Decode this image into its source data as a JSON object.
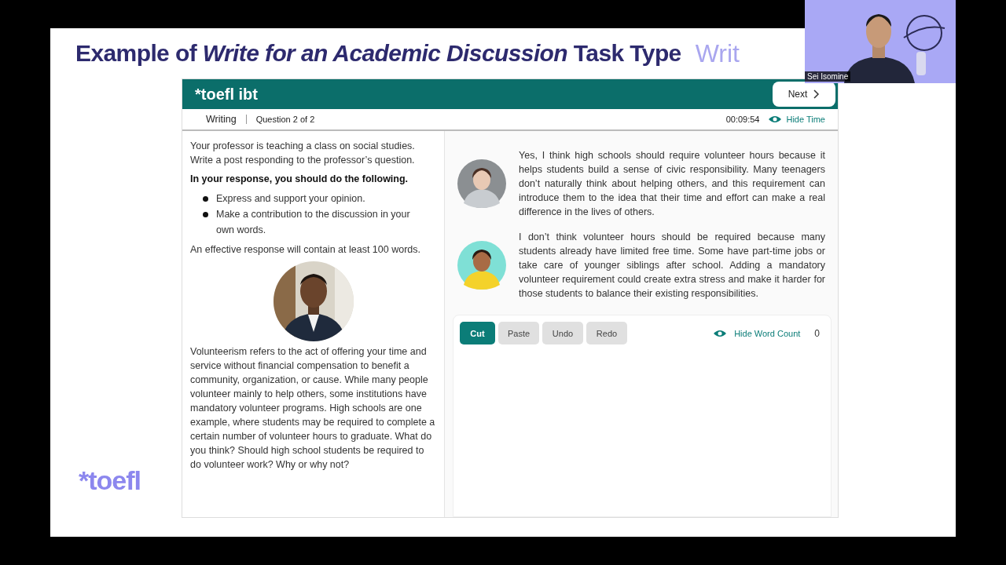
{
  "slide": {
    "title": "Example of *Write for an Academic Discussion* Task Type",
    "title_cut": "Writ",
    "logo": "*toefl"
  },
  "app": {
    "brand": "*toefl ibt",
    "next": "Next",
    "section": "Writing",
    "question": "Question 2 of 2",
    "timer": "00:09:54",
    "hide_time": "Hide Time"
  },
  "prompt": {
    "intro": "Your professor is teaching a class on social studies. Write a post responding to the professor’s question.",
    "instruction": "In your response, you should do the following.",
    "bullets": [
      "Express and support your opinion.",
      "Make a contribution to the discussion in your own words."
    ],
    "note": "An effective response will contain at least 100 words.",
    "text": "Volunteerism refers to the act of offering your time and service without financial compensation to benefit a community, organization, or cause.  While many people volunteer mainly to help others, some institutions have mandatory volunteer programs.  High schools are one example, where students may be required to complete a certain number of volunteer hours to graduate.  What do you think? Should high school students be required to do volunteer work? Why or why not?"
  },
  "posts": [
    {
      "text": "Yes, I think high schools should require volunteer hours because it helps students build a sense of civic responsibility.  Many teenagers don’t naturally think about helping others, and this requirement can introduce them to the idea that their time and effort can make a real difference in the lives of others."
    },
    {
      "text": "I don’t think volunteer hours should be required because many students already have limited free time.  Some have part-time jobs or take care of younger siblings after school.  Adding a mandatory volunteer requirement could create extra stress and make it harder for those students to balance their existing responsibilities."
    }
  ],
  "editor": {
    "buttons": [
      {
        "label": "Cut",
        "disabled": false
      },
      {
        "label": "Paste",
        "disabled": true
      },
      {
        "label": "Undo",
        "disabled": true
      },
      {
        "label": "Redo",
        "disabled": true
      }
    ],
    "hide_word_count": "Hide Word Count",
    "word_count": "0"
  },
  "video": {
    "name": "Sei Isomine"
  }
}
